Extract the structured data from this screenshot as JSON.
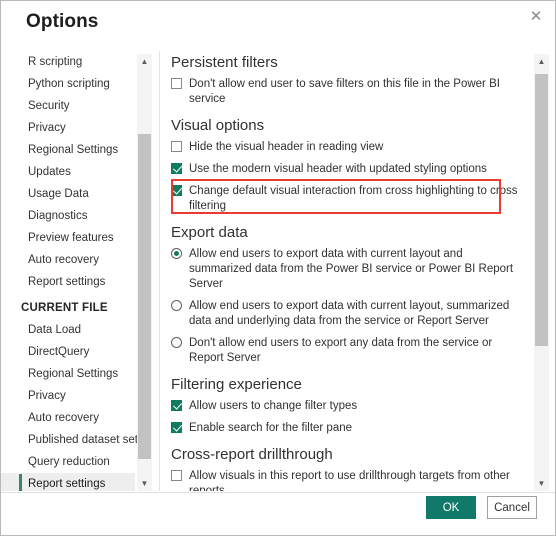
{
  "dialog": {
    "title": "Options",
    "close_icon": "close-icon"
  },
  "sidebar": {
    "global_items": [
      {
        "label": "R scripting",
        "selected": false
      },
      {
        "label": "Python scripting",
        "selected": false
      },
      {
        "label": "Security",
        "selected": false
      },
      {
        "label": "Privacy",
        "selected": false
      },
      {
        "label": "Regional Settings",
        "selected": false
      },
      {
        "label": "Updates",
        "selected": false
      },
      {
        "label": "Usage Data",
        "selected": false
      },
      {
        "label": "Diagnostics",
        "selected": false
      },
      {
        "label": "Preview features",
        "selected": false
      },
      {
        "label": "Auto recovery",
        "selected": false
      },
      {
        "label": "Report settings",
        "selected": false
      }
    ],
    "group_label": "CURRENT FILE",
    "file_items": [
      {
        "label": "Data Load",
        "selected": false
      },
      {
        "label": "DirectQuery",
        "selected": false
      },
      {
        "label": "Regional Settings",
        "selected": false
      },
      {
        "label": "Privacy",
        "selected": false
      },
      {
        "label": "Auto recovery",
        "selected": false
      },
      {
        "label": "Published dataset set...",
        "selected": false
      },
      {
        "label": "Query reduction",
        "selected": false
      },
      {
        "label": "Report settings",
        "selected": true
      }
    ],
    "scrollbar": {
      "up_arrow": "chevron-up-icon",
      "down_arrow": "chevron-down-icon"
    }
  },
  "content": {
    "scrollbar": {
      "up_arrow": "chevron-up-icon",
      "down_arrow": "chevron-down-icon"
    },
    "sections": [
      {
        "title": "Persistent filters",
        "options": [
          {
            "type": "checkbox",
            "checked": false,
            "label": "Don't allow end user to save filters on this file in the Power BI service"
          }
        ]
      },
      {
        "title": "Visual options",
        "options": [
          {
            "type": "checkbox",
            "checked": false,
            "label": "Hide the visual header in reading view"
          },
          {
            "type": "checkbox",
            "checked": true,
            "label": "Use the modern visual header with updated styling options"
          },
          {
            "type": "checkbox",
            "checked": true,
            "highlighted": true,
            "label": "Change default visual interaction from cross highlighting to cross filtering"
          }
        ]
      },
      {
        "title": "Export data",
        "options": [
          {
            "type": "radio",
            "checked": true,
            "label": "Allow end users to export data with current layout and summarized data from the Power BI service or Power BI Report Server"
          },
          {
            "type": "radio",
            "checked": false,
            "label": "Allow end users to export data with current layout, summarized data and underlying data from the service or Report Server"
          },
          {
            "type": "radio",
            "checked": false,
            "label": "Don't allow end users to export any data from the service or Report Server"
          }
        ]
      },
      {
        "title": "Filtering experience",
        "options": [
          {
            "type": "checkbox",
            "checked": true,
            "label": "Allow users to change filter types"
          },
          {
            "type": "checkbox",
            "checked": true,
            "label": "Enable search for the filter pane"
          }
        ]
      },
      {
        "title": "Cross-report drillthrough",
        "options": [
          {
            "type": "checkbox",
            "checked": false,
            "label": "Allow visuals in this report to use drillthrough targets from other reports"
          }
        ]
      }
    ]
  },
  "footer": {
    "ok_label": "OK",
    "cancel_label": "Cancel"
  },
  "colors": {
    "accent": "#11796a",
    "checkbox_checked": "#0f7b5f",
    "highlight_outline": "#e83c32",
    "selected_nav_bar": "#3b8272"
  }
}
